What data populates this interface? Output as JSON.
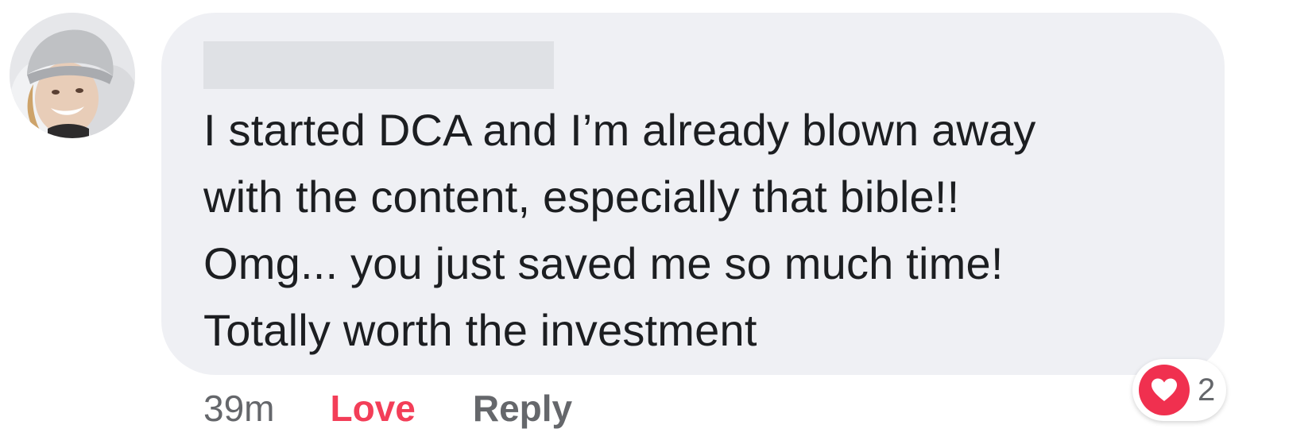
{
  "comment": {
    "lines": [
      "I started DCA and I’m already blown away",
      "with the content, especially that bible!!",
      "Omg... you just saved me so much time!",
      "Totally worth the investment"
    ]
  },
  "actions": {
    "timestamp": "39m",
    "love_label": "Love",
    "reply_label": "Reply"
  },
  "reactions": {
    "icon": "heart-icon",
    "count": "2"
  },
  "colors": {
    "bubble": "#eff0f4",
    "love": "#f33e58",
    "muted": "#65676b",
    "heart": "#f0304f"
  }
}
